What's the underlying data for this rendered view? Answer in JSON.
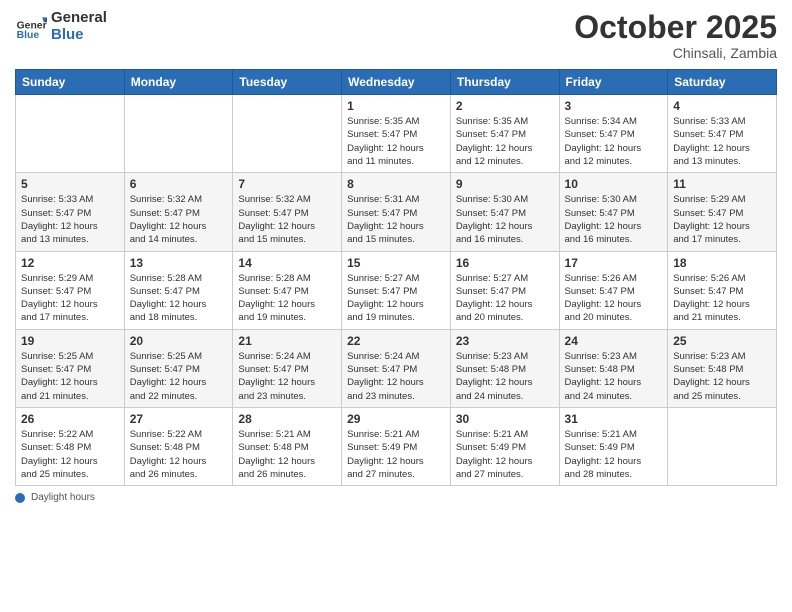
{
  "header": {
    "logo_general": "General",
    "logo_blue": "Blue",
    "month_title": "October 2025",
    "location": "Chinsali, Zambia"
  },
  "weekdays": [
    "Sunday",
    "Monday",
    "Tuesday",
    "Wednesday",
    "Thursday",
    "Friday",
    "Saturday"
  ],
  "weeks": [
    {
      "days": [
        {
          "num": "",
          "info": ""
        },
        {
          "num": "",
          "info": ""
        },
        {
          "num": "",
          "info": ""
        },
        {
          "num": "1",
          "info": "Sunrise: 5:35 AM\nSunset: 5:47 PM\nDaylight: 12 hours\nand 11 minutes."
        },
        {
          "num": "2",
          "info": "Sunrise: 5:35 AM\nSunset: 5:47 PM\nDaylight: 12 hours\nand 12 minutes."
        },
        {
          "num": "3",
          "info": "Sunrise: 5:34 AM\nSunset: 5:47 PM\nDaylight: 12 hours\nand 12 minutes."
        },
        {
          "num": "4",
          "info": "Sunrise: 5:33 AM\nSunset: 5:47 PM\nDaylight: 12 hours\nand 13 minutes."
        }
      ]
    },
    {
      "days": [
        {
          "num": "5",
          "info": "Sunrise: 5:33 AM\nSunset: 5:47 PM\nDaylight: 12 hours\nand 13 minutes."
        },
        {
          "num": "6",
          "info": "Sunrise: 5:32 AM\nSunset: 5:47 PM\nDaylight: 12 hours\nand 14 minutes."
        },
        {
          "num": "7",
          "info": "Sunrise: 5:32 AM\nSunset: 5:47 PM\nDaylight: 12 hours\nand 15 minutes."
        },
        {
          "num": "8",
          "info": "Sunrise: 5:31 AM\nSunset: 5:47 PM\nDaylight: 12 hours\nand 15 minutes."
        },
        {
          "num": "9",
          "info": "Sunrise: 5:30 AM\nSunset: 5:47 PM\nDaylight: 12 hours\nand 16 minutes."
        },
        {
          "num": "10",
          "info": "Sunrise: 5:30 AM\nSunset: 5:47 PM\nDaylight: 12 hours\nand 16 minutes."
        },
        {
          "num": "11",
          "info": "Sunrise: 5:29 AM\nSunset: 5:47 PM\nDaylight: 12 hours\nand 17 minutes."
        }
      ]
    },
    {
      "days": [
        {
          "num": "12",
          "info": "Sunrise: 5:29 AM\nSunset: 5:47 PM\nDaylight: 12 hours\nand 17 minutes."
        },
        {
          "num": "13",
          "info": "Sunrise: 5:28 AM\nSunset: 5:47 PM\nDaylight: 12 hours\nand 18 minutes."
        },
        {
          "num": "14",
          "info": "Sunrise: 5:28 AM\nSunset: 5:47 PM\nDaylight: 12 hours\nand 19 minutes."
        },
        {
          "num": "15",
          "info": "Sunrise: 5:27 AM\nSunset: 5:47 PM\nDaylight: 12 hours\nand 19 minutes."
        },
        {
          "num": "16",
          "info": "Sunrise: 5:27 AM\nSunset: 5:47 PM\nDaylight: 12 hours\nand 20 minutes."
        },
        {
          "num": "17",
          "info": "Sunrise: 5:26 AM\nSunset: 5:47 PM\nDaylight: 12 hours\nand 20 minutes."
        },
        {
          "num": "18",
          "info": "Sunrise: 5:26 AM\nSunset: 5:47 PM\nDaylight: 12 hours\nand 21 minutes."
        }
      ]
    },
    {
      "days": [
        {
          "num": "19",
          "info": "Sunrise: 5:25 AM\nSunset: 5:47 PM\nDaylight: 12 hours\nand 21 minutes."
        },
        {
          "num": "20",
          "info": "Sunrise: 5:25 AM\nSunset: 5:47 PM\nDaylight: 12 hours\nand 22 minutes."
        },
        {
          "num": "21",
          "info": "Sunrise: 5:24 AM\nSunset: 5:47 PM\nDaylight: 12 hours\nand 23 minutes."
        },
        {
          "num": "22",
          "info": "Sunrise: 5:24 AM\nSunset: 5:47 PM\nDaylight: 12 hours\nand 23 minutes."
        },
        {
          "num": "23",
          "info": "Sunrise: 5:23 AM\nSunset: 5:48 PM\nDaylight: 12 hours\nand 24 minutes."
        },
        {
          "num": "24",
          "info": "Sunrise: 5:23 AM\nSunset: 5:48 PM\nDaylight: 12 hours\nand 24 minutes."
        },
        {
          "num": "25",
          "info": "Sunrise: 5:23 AM\nSunset: 5:48 PM\nDaylight: 12 hours\nand 25 minutes."
        }
      ]
    },
    {
      "days": [
        {
          "num": "26",
          "info": "Sunrise: 5:22 AM\nSunset: 5:48 PM\nDaylight: 12 hours\nand 25 minutes."
        },
        {
          "num": "27",
          "info": "Sunrise: 5:22 AM\nSunset: 5:48 PM\nDaylight: 12 hours\nand 26 minutes."
        },
        {
          "num": "28",
          "info": "Sunrise: 5:21 AM\nSunset: 5:48 PM\nDaylight: 12 hours\nand 26 minutes."
        },
        {
          "num": "29",
          "info": "Sunrise: 5:21 AM\nSunset: 5:49 PM\nDaylight: 12 hours\nand 27 minutes."
        },
        {
          "num": "30",
          "info": "Sunrise: 5:21 AM\nSunset: 5:49 PM\nDaylight: 12 hours\nand 27 minutes."
        },
        {
          "num": "31",
          "info": "Sunrise: 5:21 AM\nSunset: 5:49 PM\nDaylight: 12 hours\nand 28 minutes."
        },
        {
          "num": "",
          "info": ""
        }
      ]
    }
  ],
  "footer": {
    "daylight_label": "Daylight hours"
  }
}
